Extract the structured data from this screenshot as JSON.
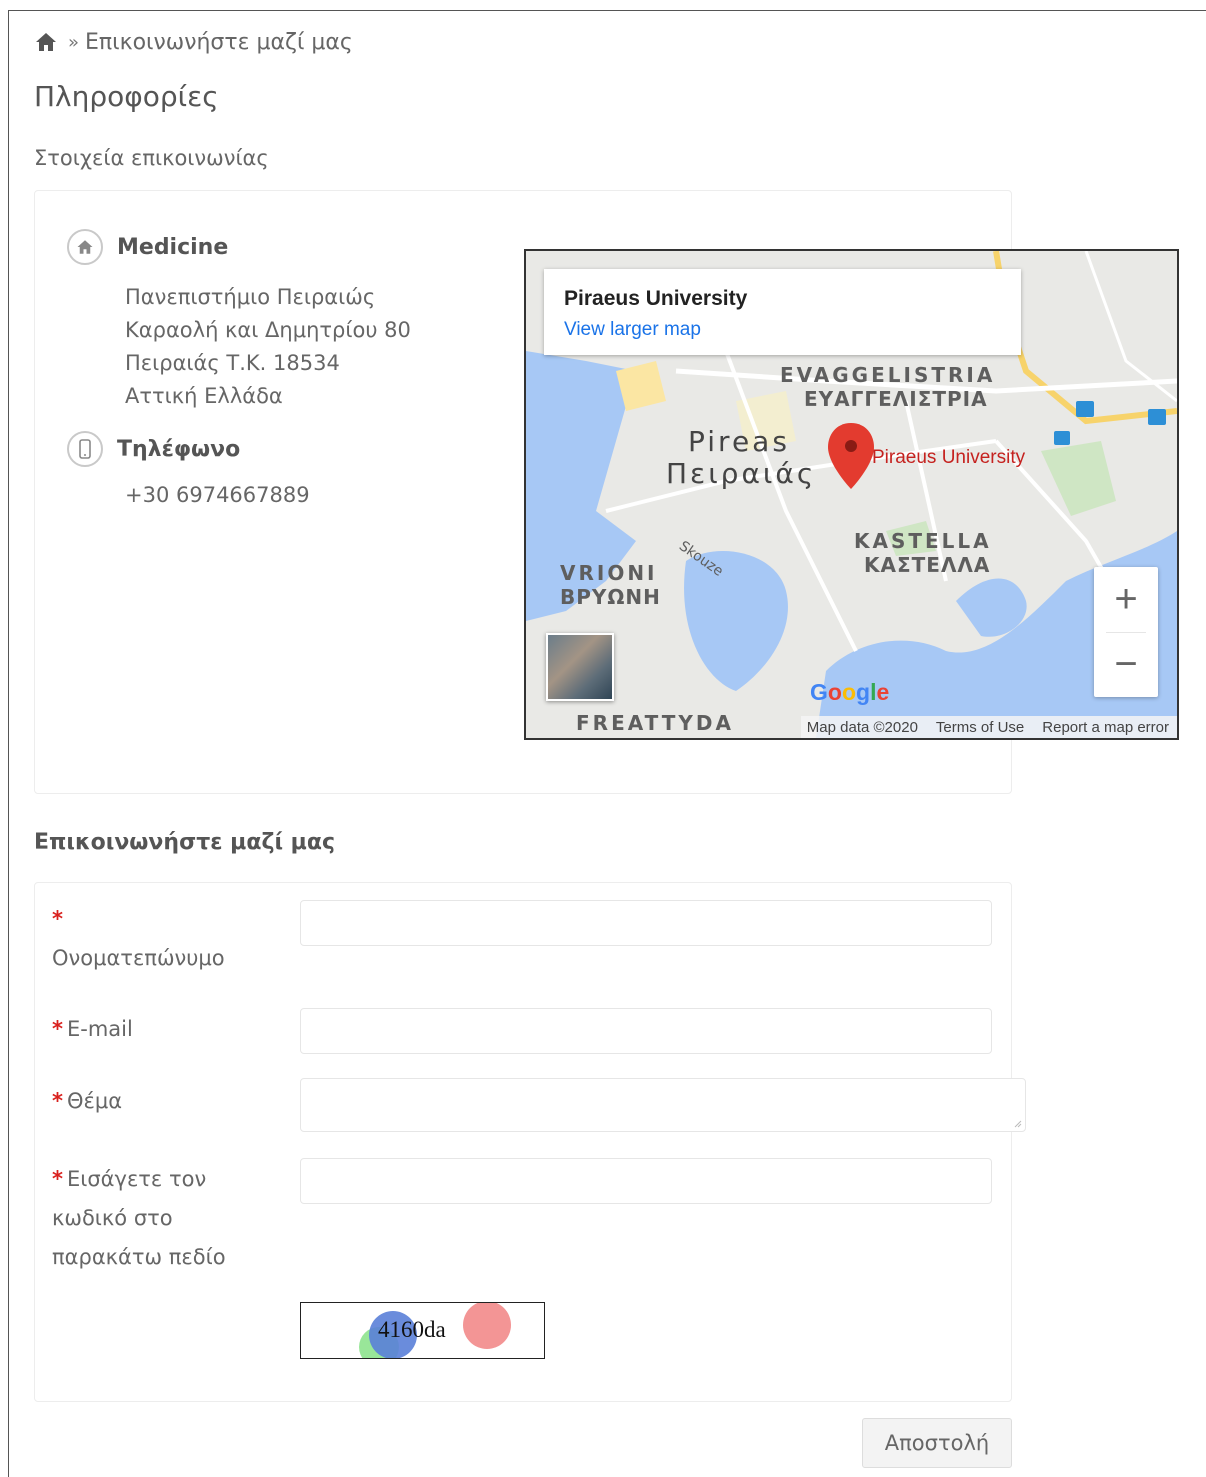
{
  "breadcrumb": {
    "separator": "»",
    "current": "Επικοινωνήστε μαζί μας"
  },
  "page_title": "Πληροφορίες",
  "contact_details_heading": "Στοιχεία επικοινωνίας",
  "contact": {
    "name": "Medicine",
    "address_lines": [
      "Πανεπιστήμιο Πειραιώς",
      "Καραολή και Δημητρίου 80",
      "Πειραιάς Τ.Κ. 18534",
      "Αττική Ελλάδα"
    ],
    "phone_heading": "Τηλέφωνο",
    "phone": "+30 6974667889"
  },
  "map": {
    "place_name": "Piraeus University",
    "larger_map_link": "View larger map",
    "marker_label": "Piraeus University",
    "labels": {
      "pireas_latin": "Pireas",
      "pireas_greek": "Πειραιάς",
      "evaggelistria_latin": "EVAGGELISTRIA",
      "evaggelistria_greek": "ΕΥΑΓΓΕΛΙΣΤΡΙΑ",
      "kastella_latin": "KASTELLA",
      "kastella_greek": "ΚΑΣΤΕΛΛΑ",
      "vrioni_latin": "VRIONI",
      "vrioni_greek": "ΒΡΥΩΝΗ",
      "freattyda": "FREATTYDA",
      "skouze": "Skouze"
    },
    "zoom_in": "+",
    "zoom_out": "−",
    "logo": "Google",
    "footer": {
      "data": "Map data ©2020",
      "terms": "Terms of Use",
      "report": "Report a map error"
    }
  },
  "form": {
    "heading": "Επικοινωνήστε μαζί μας",
    "required_mark": "*",
    "fullname_label": "Ονοματεπώνυμο",
    "email_label": "E-mail",
    "subject_label": "Θέμα",
    "captcha_label_lines": [
      "Εισάγετε τον",
      "κωδικό στο",
      "παρακάτω πεδίο"
    ],
    "captcha_code": "4160da",
    "submit_label": "Αποστολή"
  }
}
